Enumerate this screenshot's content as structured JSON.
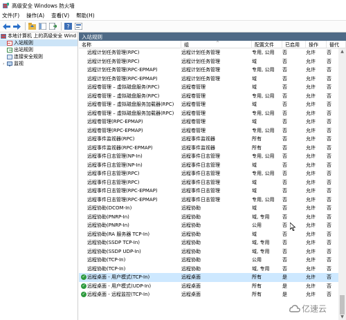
{
  "window": {
    "title": "高级安全 Windows 防火墙"
  },
  "menu": [
    "文件(F)",
    "操作(A)",
    "查看(V)",
    "帮助(H)"
  ],
  "toolbar": {
    "icons": [
      "back-arrow-icon",
      "forward-arrow-icon",
      "up-folder-icon",
      "console-tree-icon",
      "export-list-icon",
      "help-icon",
      "properties-icon"
    ]
  },
  "tree": {
    "root": "本地计算机 上的高级安全 Wind",
    "items": [
      {
        "label": "入站规则",
        "selected": true
      },
      {
        "label": "出站规则",
        "selected": false
      },
      {
        "label": "连接安全规则",
        "selected": false
      },
      {
        "label": "监视",
        "selected": false
      }
    ]
  },
  "panel": {
    "title": "入站规则"
  },
  "columns": [
    "名称",
    "组",
    "配置文件",
    "已启用",
    "操作",
    "替代"
  ],
  "rules": [
    {
      "name": "远程计划任务管理(RPC)",
      "group": "远程计划任务管理",
      "profile": "专用, 公用",
      "enabled": "否",
      "action": "允许",
      "override": "否",
      "check": false,
      "selected": false
    },
    {
      "name": "远程计划任务管理(RPC)",
      "group": "远程计划任务管理",
      "profile": "域",
      "enabled": "否",
      "action": "允许",
      "override": "否",
      "check": false,
      "selected": false
    },
    {
      "name": "远程计划任务管理(RPC-EPMAP)",
      "group": "远程计划任务管理",
      "profile": "专用, 公用",
      "enabled": "否",
      "action": "允许",
      "override": "否",
      "check": false,
      "selected": false
    },
    {
      "name": "远程计划任务管理(RPC-EPMAP)",
      "group": "远程计划任务管理",
      "profile": "域",
      "enabled": "否",
      "action": "允许",
      "override": "否",
      "check": false,
      "selected": false
    },
    {
      "name": "远程卷管理 – 虚拟磁盘服务(RPC)",
      "group": "远程卷管理",
      "profile": "域",
      "enabled": "否",
      "action": "允许",
      "override": "否",
      "check": false,
      "selected": false
    },
    {
      "name": "远程卷管理 – 虚拟磁盘服务(RPC)",
      "group": "远程卷管理",
      "profile": "专用, 公用",
      "enabled": "否",
      "action": "允许",
      "override": "否",
      "check": false,
      "selected": false
    },
    {
      "name": "远程卷管理 – 虚拟磁盘服务加载器(RPC)",
      "group": "远程卷管理",
      "profile": "域",
      "enabled": "否",
      "action": "允许",
      "override": "否",
      "check": false,
      "selected": false
    },
    {
      "name": "远程卷管理 – 虚拟磁盘服务加载器(RPC)",
      "group": "远程卷管理",
      "profile": "专用, 公用",
      "enabled": "否",
      "action": "允许",
      "override": "否",
      "check": false,
      "selected": false
    },
    {
      "name": "远程卷管理(RPC-EPMAP)",
      "group": "远程卷管理",
      "profile": "域",
      "enabled": "否",
      "action": "允许",
      "override": "否",
      "check": false,
      "selected": false
    },
    {
      "name": "远程卷管理(RPC-EPMAP)",
      "group": "远程卷管理",
      "profile": "专用, 公用",
      "enabled": "否",
      "action": "允许",
      "override": "否",
      "check": false,
      "selected": false
    },
    {
      "name": "远程事件监视器(RPC)",
      "group": "远程事件监视器",
      "profile": "所有",
      "enabled": "否",
      "action": "允许",
      "override": "否",
      "check": false,
      "selected": false
    },
    {
      "name": "远程事件监视器(RPC-EPMAP)",
      "group": "远程事件监视器",
      "profile": "所有",
      "enabled": "否",
      "action": "允许",
      "override": "否",
      "check": false,
      "selected": false
    },
    {
      "name": "远程事件日志管理(NP-In)",
      "group": "远程事件日志管理",
      "profile": "专用, 公用",
      "enabled": "否",
      "action": "允许",
      "override": "否",
      "check": false,
      "selected": false
    },
    {
      "name": "远程事件日志管理(NP-In)",
      "group": "远程事件日志管理",
      "profile": "域",
      "enabled": "否",
      "action": "允许",
      "override": "否",
      "check": false,
      "selected": false
    },
    {
      "name": "远程事件日志管理(RPC)",
      "group": "远程事件日志管理",
      "profile": "专用, 公用",
      "enabled": "否",
      "action": "允许",
      "override": "否",
      "check": false,
      "selected": false
    },
    {
      "name": "远程事件日志管理(RPC)",
      "group": "远程事件日志管理",
      "profile": "域",
      "enabled": "否",
      "action": "允许",
      "override": "否",
      "check": false,
      "selected": false
    },
    {
      "name": "远程事件日志管理(RPC-EPMAP)",
      "group": "远程事件日志管理",
      "profile": "域",
      "enabled": "否",
      "action": "允许",
      "override": "否",
      "check": false,
      "selected": false
    },
    {
      "name": "远程事件日志管理(RPC-EPMAP)",
      "group": "远程事件日志管理",
      "profile": "专用, 公用",
      "enabled": "否",
      "action": "允许",
      "override": "否",
      "check": false,
      "selected": false
    },
    {
      "name": "远程协助(DCOM-In)",
      "group": "远程协助",
      "profile": "域",
      "enabled": "否",
      "action": "允许",
      "override": "否",
      "check": false,
      "selected": false
    },
    {
      "name": "远程协助(PNRP-In)",
      "group": "远程协助",
      "profile": "域, 专用",
      "enabled": "否",
      "action": "允许",
      "override": "否",
      "check": false,
      "selected": false
    },
    {
      "name": "远程协助(PNRP-In)",
      "group": "远程协助",
      "profile": "公用",
      "enabled": "否",
      "action": "允许",
      "override": "否",
      "check": false,
      "selected": false
    },
    {
      "name": "远程协助(RA 服务器 TCP-In)",
      "group": "远程协助",
      "profile": "域",
      "enabled": "否",
      "action": "允许",
      "override": "否",
      "check": false,
      "selected": false
    },
    {
      "name": "远程协助(SSDP TCP-In)",
      "group": "远程协助",
      "profile": "域, 专用",
      "enabled": "否",
      "action": "允许",
      "override": "否",
      "check": false,
      "selected": false
    },
    {
      "name": "远程协助(SSDP UDP-In)",
      "group": "远程协助",
      "profile": "域, 专用",
      "enabled": "否",
      "action": "允许",
      "override": "否",
      "check": false,
      "selected": false
    },
    {
      "name": "远程协助(TCP-In)",
      "group": "远程协助",
      "profile": "公用",
      "enabled": "否",
      "action": "允许",
      "override": "否",
      "check": false,
      "selected": false
    },
    {
      "name": "远程协助(TCP-In)",
      "group": "远程协助",
      "profile": "域, 专用",
      "enabled": "否",
      "action": "允许",
      "override": "否",
      "check": false,
      "selected": false
    },
    {
      "name": "远程桌面 - 用户模式(TCP-In)",
      "group": "远程桌面",
      "profile": "所有",
      "enabled": "是",
      "action": "允许",
      "override": "否",
      "check": true,
      "selected": true
    },
    {
      "name": "远程桌面 - 用户模式(UDP-In)",
      "group": "远程桌面",
      "profile": "所有",
      "enabled": "是",
      "action": "允许",
      "override": "否",
      "check": true,
      "selected": false
    },
    {
      "name": "远程桌面 - 远程监控(TCP-In)",
      "group": "远程桌面",
      "profile": "所有",
      "enabled": "是",
      "action": "允许",
      "override": "否",
      "check": true,
      "selected": false
    }
  ],
  "watermark": {
    "text": "亿速云"
  },
  "colors": {
    "header_bar": "#4f6a86",
    "selected_row": "#cde8ff",
    "enabled_check": "#2e9a3e"
  }
}
